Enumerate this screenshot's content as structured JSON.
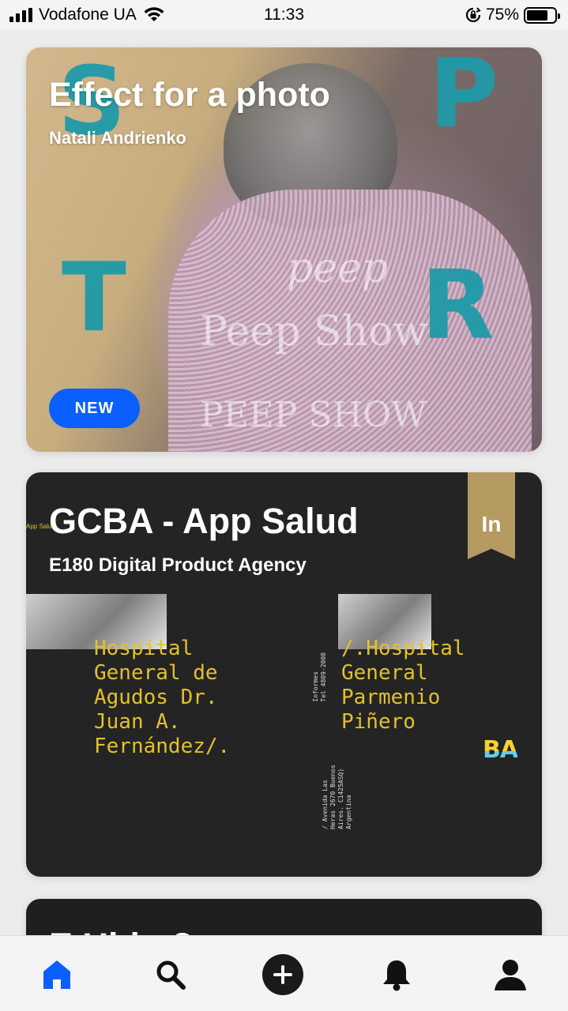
{
  "status_bar": {
    "carrier": "Vodafone UA",
    "time": "11:33",
    "battery_percent": "75%",
    "battery_level": 0.75,
    "icons": [
      "signal-bars-icon",
      "wifi-icon",
      "rotation-lock-icon",
      "battery-icon"
    ]
  },
  "feed": {
    "cards": [
      {
        "title": "Effect for a photo",
        "author": "Natali Andrienko",
        "badge": "NEW",
        "decor_letters": [
          "S",
          "P",
          "T",
          "R"
        ],
        "decor_text": [
          "Peep Show",
          "peep",
          "PEEP SHOW"
        ]
      },
      {
        "title": "GCBA - App Salud",
        "author": "E180 Digital Product Agency",
        "ribbon": "In",
        "corner_label": "App Salud",
        "hospital_left": "Hospital\nGeneral de\nAgudos Dr.\nJuan A.\nFernández/.",
        "hospital_right": "/.Hospital\nGeneral\nParmenio\nPiñero",
        "info_top": "Informes\nTel 4809-2000",
        "info_bottom": "/ Avenida Las\nHeras 2670 Buenos\nAires. C1425ASQ)\nArgentina",
        "logo_text": "BA"
      },
      {
        "title": "E              Ubiq  ?"
      }
    ]
  },
  "tab_bar": {
    "active": "home",
    "items": [
      "home-icon",
      "search-icon",
      "add-icon",
      "notifications-icon",
      "profile-icon"
    ]
  },
  "colors": {
    "accent_blue": "#0b5fff",
    "ribbon_gold": "#b59a62",
    "hospital_yellow": "#e2c12c",
    "card_dark": "#242424"
  }
}
